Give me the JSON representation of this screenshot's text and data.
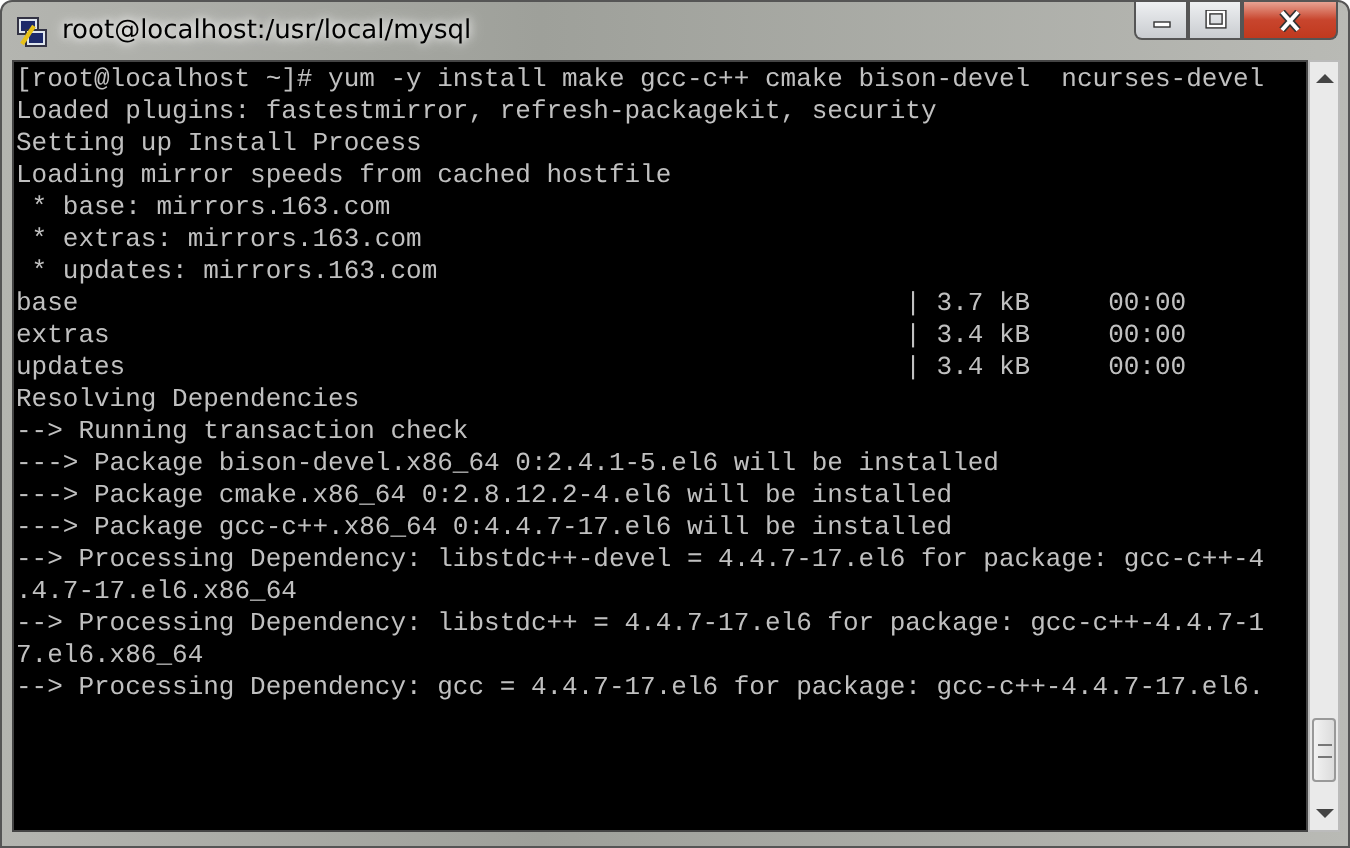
{
  "window": {
    "title": "root@localhost:/usr/local/mysql"
  },
  "terminal": {
    "lines": [
      {
        "kind": "text",
        "text": "[root@localhost ~]# yum -y install make gcc-c++ cmake bison-devel  ncurses-devel"
      },
      {
        "kind": "text",
        "text": "Loaded plugins: fastestmirror, refresh-packagekit, security"
      },
      {
        "kind": "text",
        "text": "Setting up Install Process"
      },
      {
        "kind": "text",
        "text": "Loading mirror speeds from cached hostfile"
      },
      {
        "kind": "text",
        "text": " * base: mirrors.163.com"
      },
      {
        "kind": "text",
        "text": " * extras: mirrors.163.com"
      },
      {
        "kind": "text",
        "text": " * updates: mirrors.163.com"
      },
      {
        "kind": "repo",
        "cells": [
          "base",
          "| 3.7 kB",
          "00:00"
        ]
      },
      {
        "kind": "repo",
        "cells": [
          "extras",
          "| 3.4 kB",
          "00:00"
        ]
      },
      {
        "kind": "repo",
        "cells": [
          "updates",
          "| 3.4 kB",
          "00:00"
        ]
      },
      {
        "kind": "text",
        "text": "Resolving Dependencies"
      },
      {
        "kind": "text",
        "text": "--> Running transaction check"
      },
      {
        "kind": "text",
        "text": "---> Package bison-devel.x86_64 0:2.4.1-5.el6 will be installed"
      },
      {
        "kind": "text",
        "text": "---> Package cmake.x86_64 0:2.8.12.2-4.el6 will be installed"
      },
      {
        "kind": "text",
        "text": "---> Package gcc-c++.x86_64 0:4.4.7-17.el6 will be installed"
      },
      {
        "kind": "text",
        "text": "--> Processing Dependency: libstdc++-devel = 4.4.7-17.el6 for package: gcc-c++-4"
      },
      {
        "kind": "text",
        "text": ".4.7-17.el6.x86_64"
      },
      {
        "kind": "text",
        "text": "--> Processing Dependency: libstdc++ = 4.4.7-17.el6 for package: gcc-c++-4.4.7-1"
      },
      {
        "kind": "text",
        "text": "7.el6.x86_64"
      },
      {
        "kind": "text",
        "text": "--> Processing Dependency: gcc = 4.4.7-17.el6 for package: gcc-c++-4.4.7-17.el6."
      }
    ]
  }
}
